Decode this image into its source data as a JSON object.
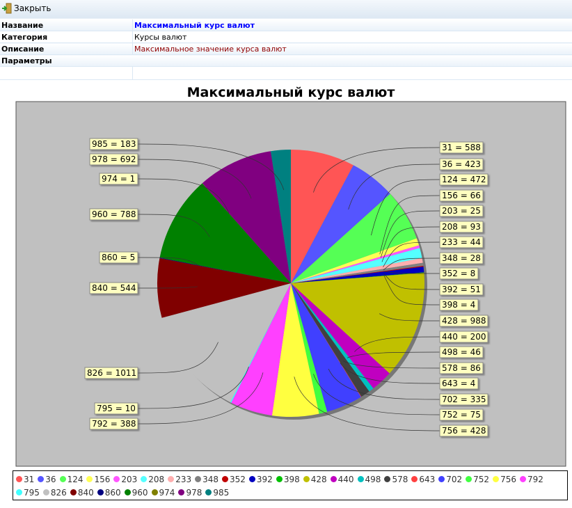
{
  "toolbar": {
    "close_label": "Закрыть"
  },
  "props": {
    "name_key": "Название",
    "name_val": "Максимальный курс валют",
    "cat_key": "Категория",
    "cat_val": "Курсы валют",
    "desc_key": "Описание",
    "desc_val": "Максимальное значение курса валют",
    "params_key": "Параметры"
  },
  "chart_data": {
    "type": "pie",
    "title": "Максимальный курс валют",
    "legend_position": "bottom",
    "labels": [
      "31",
      "36",
      "124",
      "156",
      "203",
      "208",
      "233",
      "348",
      "352",
      "392",
      "398",
      "428",
      "440",
      "498",
      "578",
      "643",
      "702",
      "752",
      "756",
      "792",
      "795",
      "826",
      "840",
      "860",
      "960",
      "974",
      "978",
      "985"
    ],
    "values": [
      588,
      423,
      472,
      66,
      25,
      93,
      44,
      28,
      8,
      51,
      4,
      988,
      200,
      46,
      86,
      4,
      335,
      75,
      428,
      388,
      10,
      1011,
      544,
      5,
      788,
      1,
      692,
      183
    ],
    "colors": [
      "#ff5555",
      "#5555ff",
      "#55ff55",
      "#ffff55",
      "#ff55ff",
      "#55ffff",
      "#ffafaf",
      "#808080",
      "#c00000",
      "#0000c0",
      "#00c000",
      "#c0c000",
      "#c000c0",
      "#00c0c0",
      "#404040",
      "#ff4040",
      "#4040ff",
      "#40ff40",
      "#ffff40",
      "#ff40ff",
      "#40ffff",
      "#c0c0c0",
      "#800000",
      "#000080",
      "#008000",
      "#808000",
      "#800080",
      "#008080"
    ]
  }
}
